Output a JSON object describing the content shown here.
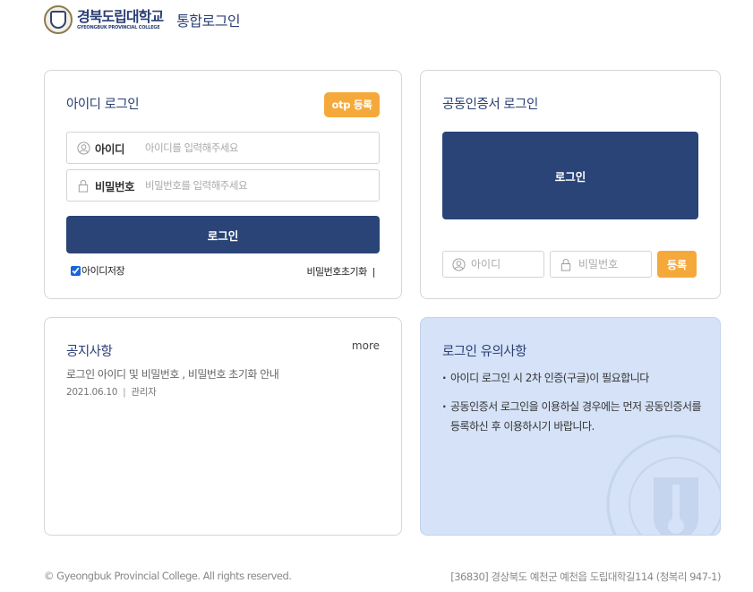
{
  "header": {
    "logo_kr": "경북도립대학교",
    "logo_en": "GYEONGBUK PROVINCIAL COLLEGE",
    "title": "통합로그인"
  },
  "id_login": {
    "title": "아이디 로그인",
    "otp_button": "otp 등록",
    "id_label": "아이디",
    "id_placeholder": "아이디를 입력해주세요",
    "pw_label": "비밀번호",
    "pw_placeholder": "비밀번호를 입력해주세요",
    "login_button": "로그인",
    "save_id_label": "아이디저장",
    "reset_password": "비밀번호초기화",
    "reset_separator": "|"
  },
  "cert_login": {
    "title": "공동인증서 로그인",
    "login_button": "로그인",
    "id_placeholder": "아이디",
    "pw_placeholder": "비밀번호",
    "register_button": "등록"
  },
  "notice": {
    "title": "공지사항",
    "more": "more",
    "items": [
      {
        "title": "로그인 아이디 및 비밀번호 , 비밀번호 초기화 안내",
        "date": "2021.06.10",
        "author": "관리자"
      }
    ]
  },
  "caution": {
    "title": "로그인 유의사항",
    "items": [
      "아이디 로그인 시 2차 인증(구글)이 필요합니다",
      "공동인증서 로그인을 이용하실 경우에는 먼저 공동인증서를 등록하신 후 이용하시기 바랍니다."
    ]
  },
  "footer": {
    "copyright": "© Gyeongbuk Provincial College. All rights reserved.",
    "address": "[36830] 경상북도 예천군 예천읍 도립대학길114 (청복리 947-1)"
  },
  "colors": {
    "navy": "#2a4478",
    "orange": "#f5a93b",
    "caution_bg": "#d5e2f7"
  }
}
